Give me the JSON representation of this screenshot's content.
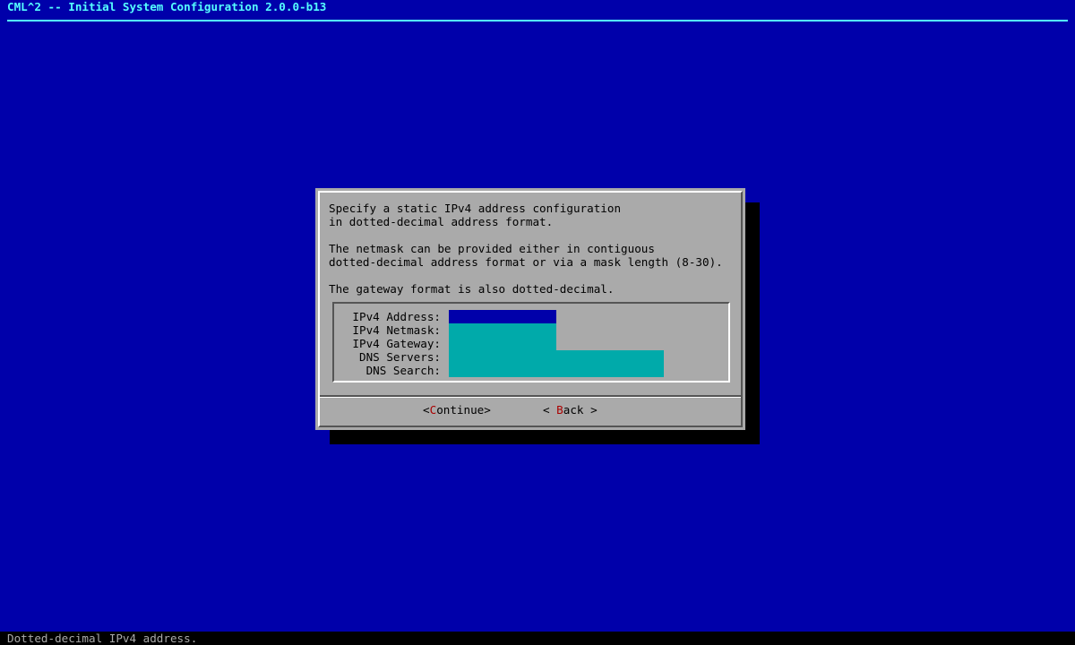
{
  "header": {
    "title": "CML^2 -- Initial System Configuration 2.0.0-b13"
  },
  "dialog": {
    "message_lines": [
      "Specify a static IPv4 address configuration",
      "in dotted-decimal address format.",
      "The netmask can be provided either in contiguous",
      "dotted-decimal address format or via a mask length (8-30).",
      "The gateway format is also dotted-decimal."
    ],
    "fields": [
      {
        "label": "IPv4 Address:",
        "value": ""
      },
      {
        "label": "IPv4 Netmask:",
        "value": ""
      },
      {
        "label": "IPv4 Gateway:",
        "value": ""
      },
      {
        "label": "DNS Servers:",
        "value": ""
      },
      {
        "label": "DNS Search:",
        "value": ""
      }
    ],
    "buttons": {
      "continue": {
        "open": "<",
        "hotkey": "C",
        "rest": "ontinue",
        "close": ">"
      },
      "back": {
        "open": "< ",
        "hotkey": "B",
        "rest": "ack",
        "close": " >"
      }
    }
  },
  "status_bar": {
    "text": "Dotted-decimal IPv4 address."
  },
  "colors": {
    "background": "#0000aa",
    "title": "#55ffff",
    "dialog": "#aaaaaa",
    "input": "#00aaaa",
    "focused_input": "#0000aa",
    "hotkey": "#aa0000",
    "status_bar": "#000000"
  }
}
